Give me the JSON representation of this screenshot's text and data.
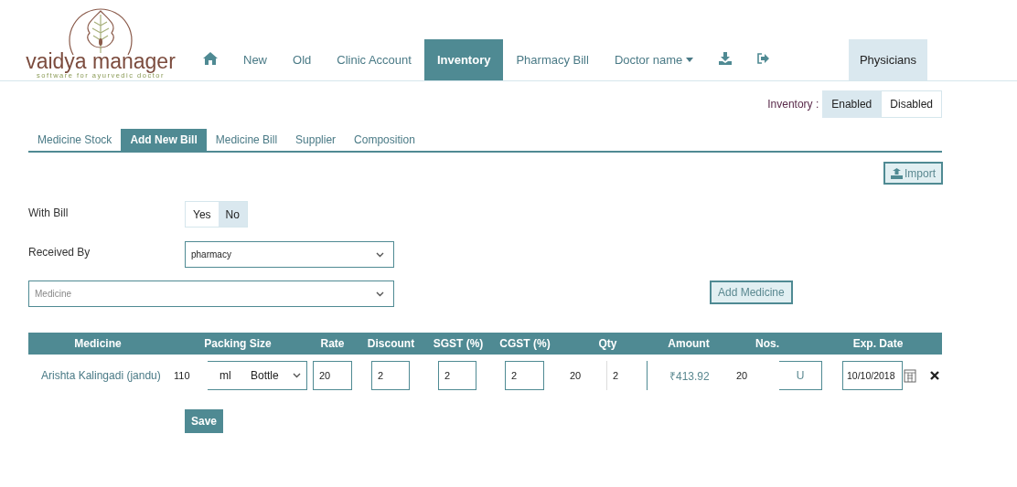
{
  "logo": {
    "name": "vaidya manager",
    "tagline": "software for ayurvedic doctor"
  },
  "nav": [
    {
      "kind": "home",
      "selected": false
    },
    {
      "kind": "link",
      "label": "New",
      "selected": false
    },
    {
      "kind": "link",
      "label": "Old",
      "selected": false
    },
    {
      "kind": "link",
      "label": "Clinic Account",
      "selected": false
    },
    {
      "kind": "link",
      "label": "Inventory",
      "selected": true
    },
    {
      "kind": "link",
      "label": "Pharmacy Bill",
      "selected": false
    },
    {
      "kind": "dropdown",
      "label": "Doctor name",
      "selected": false
    },
    {
      "kind": "download",
      "selected": false
    },
    {
      "kind": "logout",
      "selected": false
    }
  ],
  "physicians_button": "Physicians",
  "inventory_toggle": {
    "label": "Inventory :",
    "options": [
      {
        "label": "Enabled",
        "selected": true
      },
      {
        "label": "Disabled",
        "selected": false
      }
    ]
  },
  "subtabs": [
    {
      "label": "Medicine Stock",
      "selected": false
    },
    {
      "label": "Add New Bill",
      "selected": true
    },
    {
      "label": "Medicine Bill",
      "selected": false
    },
    {
      "label": "Supplier",
      "selected": false
    },
    {
      "label": "Composition",
      "selected": false
    }
  ],
  "import_button": "Import",
  "with_bill": {
    "label": "With Bill",
    "options": [
      {
        "label": "Yes",
        "selected": false
      },
      {
        "label": "No",
        "selected": true
      }
    ]
  },
  "received_by": {
    "label": "Received By",
    "value": "pharmacy"
  },
  "medicine_select": {
    "placeholder": "Medicine"
  },
  "add_medicine_button": "Add Medicine",
  "table": {
    "columns": [
      "Medicine",
      "Packing Size",
      "Rate",
      "Discount",
      "SGST (%)",
      "CGST (%)",
      "Qty",
      "Amount",
      "Nos.",
      "Exp. Date"
    ],
    "rows": [
      {
        "medicine": "Arishta Kalingadi (jandu)",
        "size": "110",
        "unit": "ml",
        "pack": "Bottle",
        "rate": "20",
        "discount": "2",
        "sgst": "2",
        "cgst": "2",
        "qty_total": "20",
        "qty": "2",
        "amount": "₹413.92",
        "nos": "20",
        "nos_unit": "U",
        "exp_date": "10/10/2018"
      }
    ]
  },
  "save_button": "Save"
}
